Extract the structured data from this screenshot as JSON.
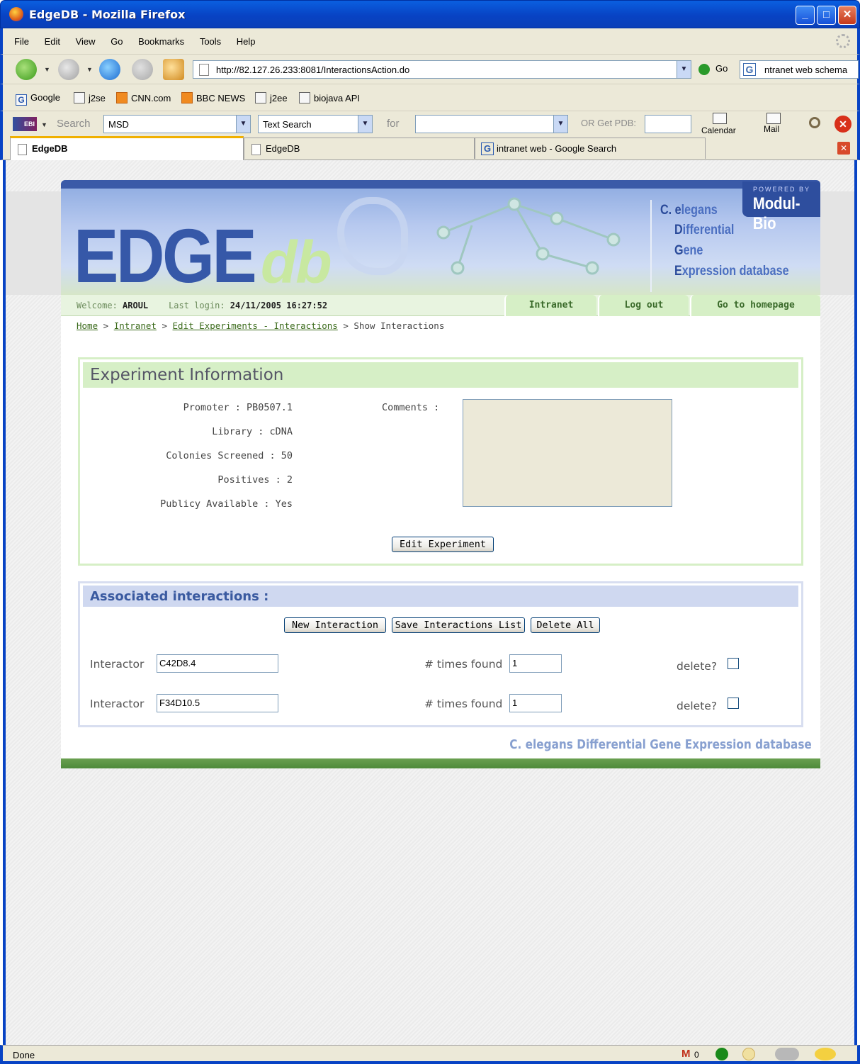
{
  "window": {
    "title": "EdgeDB - Mozilla Firefox"
  },
  "menu": [
    "File",
    "Edit",
    "View",
    "Go",
    "Bookmarks",
    "Tools",
    "Help"
  ],
  "nav": {
    "url": "http://82.127.26.233:8081/InteractionsAction.do",
    "go_label": "Go",
    "search_value": "ntranet web schema"
  },
  "bookmarks": [
    "Google",
    "j2se",
    "CNN.com",
    "BBC NEWS",
    "j2ee",
    "biojava API"
  ],
  "ebi_toolbar": {
    "search_label": "Search",
    "database_value": "MSD",
    "search_type_value": "Text Search",
    "for_label": "for",
    "for_value": "",
    "pdb_label": "OR Get PDB:",
    "calendar_label": "Calendar",
    "mail_label": "Mail"
  },
  "tabs": [
    {
      "label": "EdgeDB",
      "active": true
    },
    {
      "label": "EdgeDB",
      "active": false
    },
    {
      "label": "intranet web - Google Search",
      "active": false
    }
  ],
  "site": {
    "logo_main": "EDGE",
    "logo_suffix": "db",
    "powered_by": "POWERED BY",
    "powered_name": "Modul-Bio",
    "acronym": {
      "line1_a": "C. e",
      "line1_b": "legans",
      "line2_a": "D",
      "line2_b": "ifferential",
      "line3_a": "G",
      "line3_b": "ene",
      "line4_a": "E",
      "line4_b": "xpression database"
    },
    "welcome_label": "Welcome:",
    "user": "AROUL",
    "last_login_label": "Last login:",
    "last_login": "24/11/2005 16:27:52",
    "nav_links": [
      "Intranet",
      "Log out",
      "Go to homepage"
    ],
    "breadcrumb": {
      "home": "Home",
      "intranet": "Intranet",
      "edit": "Edit Experiments - Interactions",
      "current": "Show Interactions",
      "sep": ">"
    }
  },
  "experiment": {
    "heading": "Experiment Information",
    "promoter": "Promoter : PB0507.1",
    "library": "Library : cDNA",
    "colonies": "Colonies Screened : 50",
    "positives": "Positives : 2",
    "public": "Publicy Available :  Yes",
    "comments_label": "Comments :",
    "comments_value": "",
    "edit_button": "Edit Experiment"
  },
  "interactions": {
    "heading": "Associated interactions :",
    "buttons": {
      "new": "New Interaction",
      "save": "Save Interactions List",
      "delete_all": "Delete All"
    },
    "interactor_label": "Interactor",
    "times_label": "# times found",
    "delete_label": "delete?",
    "rows": [
      {
        "interactor": "C42D8.4",
        "times": "1",
        "delete": false
      },
      {
        "interactor": "F34D10.5",
        "times": "1",
        "delete": false
      }
    ]
  },
  "footer": {
    "text": "C. elegans Differential Gene Expression database"
  },
  "status": {
    "text": "Done",
    "gmail_count": "0"
  },
  "colors": {
    "xp_blue": "#0843c4",
    "green_band": "#d6efc6",
    "blue_band": "#cfd8f0",
    "footer_green": "#5a9646"
  }
}
